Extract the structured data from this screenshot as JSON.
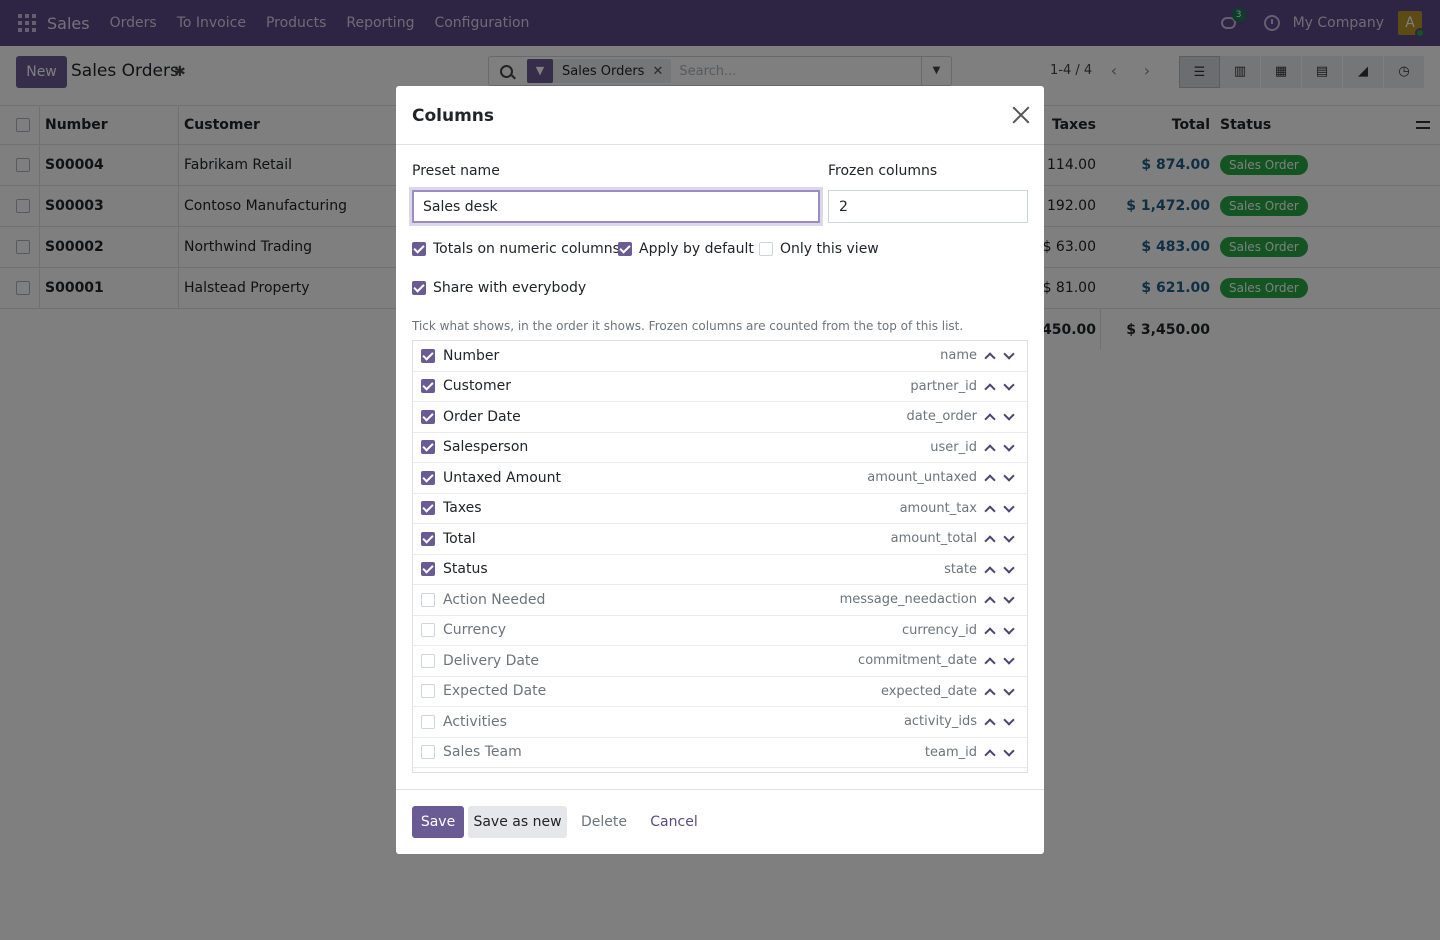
{
  "navbar": {
    "app_name": "Sales",
    "menu": [
      "Orders",
      "To Invoice",
      "Products",
      "Reporting",
      "Configuration"
    ],
    "chat_count": "3",
    "company": "My Company",
    "avatar_letter": "A"
  },
  "control_panel": {
    "new_label": "New",
    "title": "Sales Orders",
    "search_facet": "Sales Orders",
    "search_placeholder": "Search...",
    "pager": "1-4 / 4",
    "views": [
      "list-icon",
      "kanban-icon",
      "calendar-icon",
      "pivot-icon",
      "graph-icon",
      "activity-icon"
    ]
  },
  "list": {
    "headers": {
      "number": "Number",
      "customer": "Customer",
      "taxes": "Taxes",
      "total": "Total",
      "status": "Status"
    },
    "rows": [
      {
        "number": "S00004",
        "customer": "Fabrikam Retail",
        "taxes": "$ 114.00",
        "total": "$ 874.00",
        "status": "Sales Order"
      },
      {
        "number": "S00003",
        "customer": "Contoso Manufacturing",
        "taxes": "$ 192.00",
        "total": "$ 1,472.00",
        "status": "Sales Order"
      },
      {
        "number": "S00002",
        "customer": "Northwind Trading",
        "taxes": "$ 63.00",
        "total": "$ 483.00",
        "status": "Sales Order"
      },
      {
        "number": "S00001",
        "customer": "Halstead Property",
        "taxes": "$ 81.00",
        "total": "$ 621.00",
        "status": "Sales Order"
      }
    ],
    "totals": {
      "taxes": "$ 450.00",
      "total": "$ 3,450.00"
    }
  },
  "modal": {
    "title": "Columns",
    "preset_name_label": "Preset name",
    "preset_name_value": "Sales desk",
    "frozen_label": "Frozen columns",
    "frozen_value": "2",
    "options": {
      "totals": {
        "label": "Totals on numeric columns",
        "checked": true
      },
      "apply_default": {
        "label": "Apply by default",
        "checked": true
      },
      "only_view": {
        "label": "Only this view",
        "checked": false
      },
      "share": {
        "label": "Share with everybody",
        "checked": true
      }
    },
    "hint": "Tick what shows, in the order it shows. Frozen columns are counted from the top of this list.",
    "columns": [
      {
        "label": "Number",
        "field": "name",
        "checked": true
      },
      {
        "label": "Customer",
        "field": "partner_id",
        "checked": true
      },
      {
        "label": "Order Date",
        "field": "date_order",
        "checked": true
      },
      {
        "label": "Salesperson",
        "field": "user_id",
        "checked": true
      },
      {
        "label": "Untaxed Amount",
        "field": "amount_untaxed",
        "checked": true
      },
      {
        "label": "Taxes",
        "field": "amount_tax",
        "checked": true
      },
      {
        "label": "Total",
        "field": "amount_total",
        "checked": true
      },
      {
        "label": "Status",
        "field": "state",
        "checked": true
      },
      {
        "label": "Action Needed",
        "field": "message_needaction",
        "checked": false
      },
      {
        "label": "Currency",
        "field": "currency_id",
        "checked": false
      },
      {
        "label": "Delivery Date",
        "field": "commitment_date",
        "checked": false
      },
      {
        "label": "Expected Date",
        "field": "expected_date",
        "checked": false
      },
      {
        "label": "Activities",
        "field": "activity_ids",
        "checked": false
      },
      {
        "label": "Sales Team",
        "field": "team_id",
        "checked": false
      }
    ],
    "buttons": {
      "save": "Save",
      "save_as_new": "Save as new",
      "delete": "Delete",
      "cancel": "Cancel"
    }
  },
  "colors": {
    "brand": "#5b4a86",
    "primary": "#6b5b95",
    "success": "#28a745",
    "money": "#1f5f88"
  }
}
